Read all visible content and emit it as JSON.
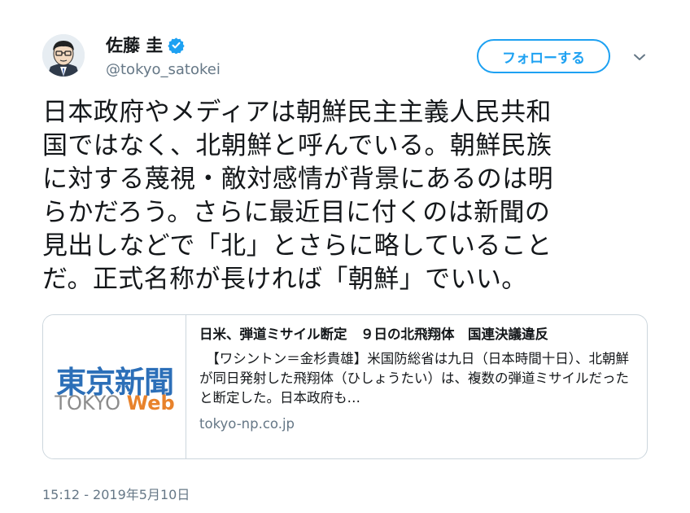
{
  "user": {
    "display_name": "佐藤 圭",
    "handle": "@tokyo_satokei",
    "verified": true
  },
  "follow_button_label": "フォローする",
  "tweet": {
    "text": "日本政府やメディアは朝鮮民主主義人民共和\n国ではなく、北朝鮮と呼んでいる。朝鮮民族\nに対する蔑視・敵対感情が背景にあるのは明\nらかだろう。さらに最近目に付くのは新聞の\n見出しなどで「北」とさらに略していること\nだ。正式名称が長ければ「朝鮮」でいい。"
  },
  "card": {
    "logo_kanji": "東京新聞",
    "logo_tokyo": "TOKYO",
    "logo_web": "Web",
    "title": "日米、弾道ミサイル断定　９日の北飛翔体　国連決議違反",
    "description": "　【ワシントン＝金杉貴雄】米国防総省は九日（日本時間十日）、北朝鮮が同日発射した飛翔体（ひしょうたい）は、複数の弾道ミサイルだったと断定した。日本政府も…",
    "domain": "tokyo-np.co.jp"
  },
  "timestamp": "15:12 - 2019年5月10日",
  "colors": {
    "accent": "#1da1f2",
    "text": "#14171a",
    "muted": "#657786",
    "border": "#ccd6dd",
    "logo_blue": "#2c6fb8",
    "logo_orange": "#e8822b"
  },
  "icons": {
    "verified": "verified-badge-icon",
    "caret": "chevron-down-icon"
  }
}
